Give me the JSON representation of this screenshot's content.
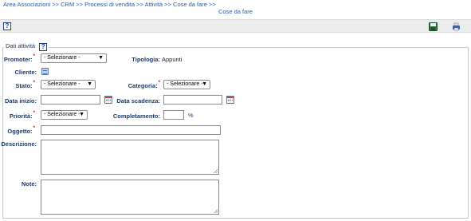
{
  "breadcrumb": "Area Associazioni >> CRM >> Processi di vendita >> Attività >> Cose da fare >>",
  "page_title": "Cose da fare",
  "toolbar": {
    "help": "?",
    "save_icon": "save-disk-icon",
    "print_icon": "printer-icon"
  },
  "section": {
    "title": "Dati attività",
    "help": "?"
  },
  "form": {
    "promoter": {
      "label": "Promoter:",
      "required": "*",
      "value": "- Selezionare -"
    },
    "tipologia": {
      "label": "Tipologia:",
      "value": "Appunti"
    },
    "cliente": {
      "label": "Cliente:"
    },
    "stato": {
      "label": "Stato:",
      "required": "*",
      "value": "- Selezionare -"
    },
    "categoria": {
      "label": "Categoria:",
      "required": "*",
      "value": "- Selezionare -"
    },
    "data_inizio": {
      "label": "Data inizio:",
      "value": ""
    },
    "data_scadenza": {
      "label": "Data scadenza:",
      "value": ""
    },
    "priorita": {
      "label": "Priorità:",
      "required": "*",
      "value": "- Selezionare -"
    },
    "completamento": {
      "label": "Completamento:",
      "value": "",
      "unit": "%"
    },
    "oggetto": {
      "label": "Oggetto:",
      "required": "*",
      "value": ""
    },
    "descrizione": {
      "label": "Descrizione:",
      "value": ""
    },
    "note": {
      "label": "Note:",
      "value": ""
    }
  }
}
